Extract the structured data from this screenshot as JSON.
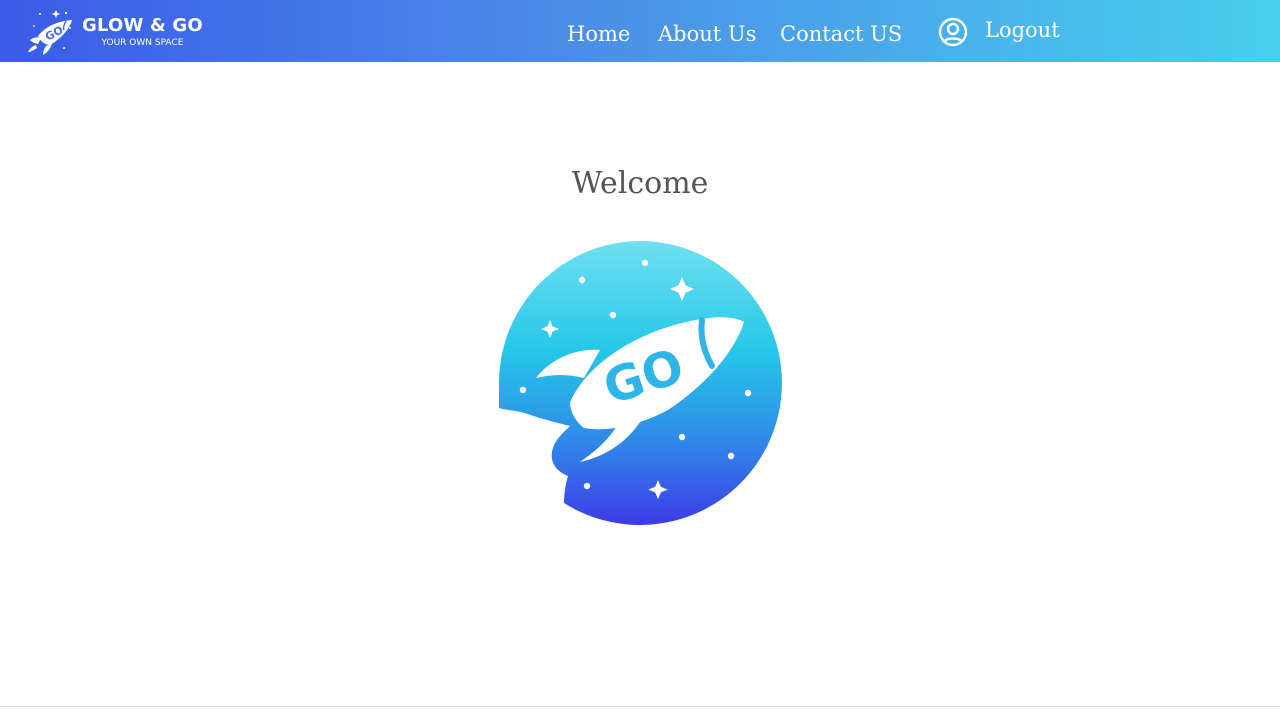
{
  "brand": {
    "title": "GLOW & GO",
    "subtitle": "YOUR OWN SPACE",
    "icon": "rocket-logo-icon"
  },
  "nav": {
    "home": "Home",
    "about": "About Us",
    "contact": "Contact US",
    "logout": "Logout",
    "user_icon": "user-circle-icon"
  },
  "main": {
    "welcome": "Welcome",
    "hero_logo_text": "GO",
    "hero_icon": "rocket-go-logo-icon"
  },
  "colors": {
    "nav_gradient_start": "#3b5be8",
    "nav_gradient_end": "#48cfee",
    "logo_gradient_top": "#6fe0f0",
    "logo_gradient_mid": "#26c8e8",
    "logo_gradient_bottom": "#3d3ce8",
    "welcome_text": "#555555"
  }
}
